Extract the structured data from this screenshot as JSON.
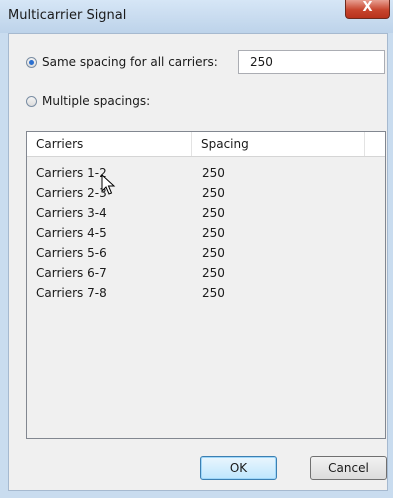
{
  "window": {
    "title": "Multicarrier Signal",
    "close_glyph": "X"
  },
  "options": {
    "same_spacing": {
      "label": "Same spacing for all carriers:",
      "selected": true,
      "value": "250"
    },
    "multiple_spacings": {
      "label": "Multiple spacings:",
      "selected": false
    }
  },
  "table": {
    "columns": [
      "Carriers",
      "Spacing"
    ],
    "rows": [
      {
        "carriers": "Carriers 1-2",
        "spacing": "250"
      },
      {
        "carriers": "Carriers 2-3",
        "spacing": "250"
      },
      {
        "carriers": "Carriers 3-4",
        "spacing": "250"
      },
      {
        "carriers": "Carriers 4-5",
        "spacing": "250"
      },
      {
        "carriers": "Carriers 5-6",
        "spacing": "250"
      },
      {
        "carriers": "Carriers 6-7",
        "spacing": "250"
      },
      {
        "carriers": "Carriers 7-8",
        "spacing": "250"
      }
    ]
  },
  "buttons": {
    "ok": "OK",
    "cancel": "Cancel"
  },
  "colors": {
    "frame": "#c9dcef",
    "close_button": "#c7452e",
    "radio_dot": "#2a6fd0"
  }
}
